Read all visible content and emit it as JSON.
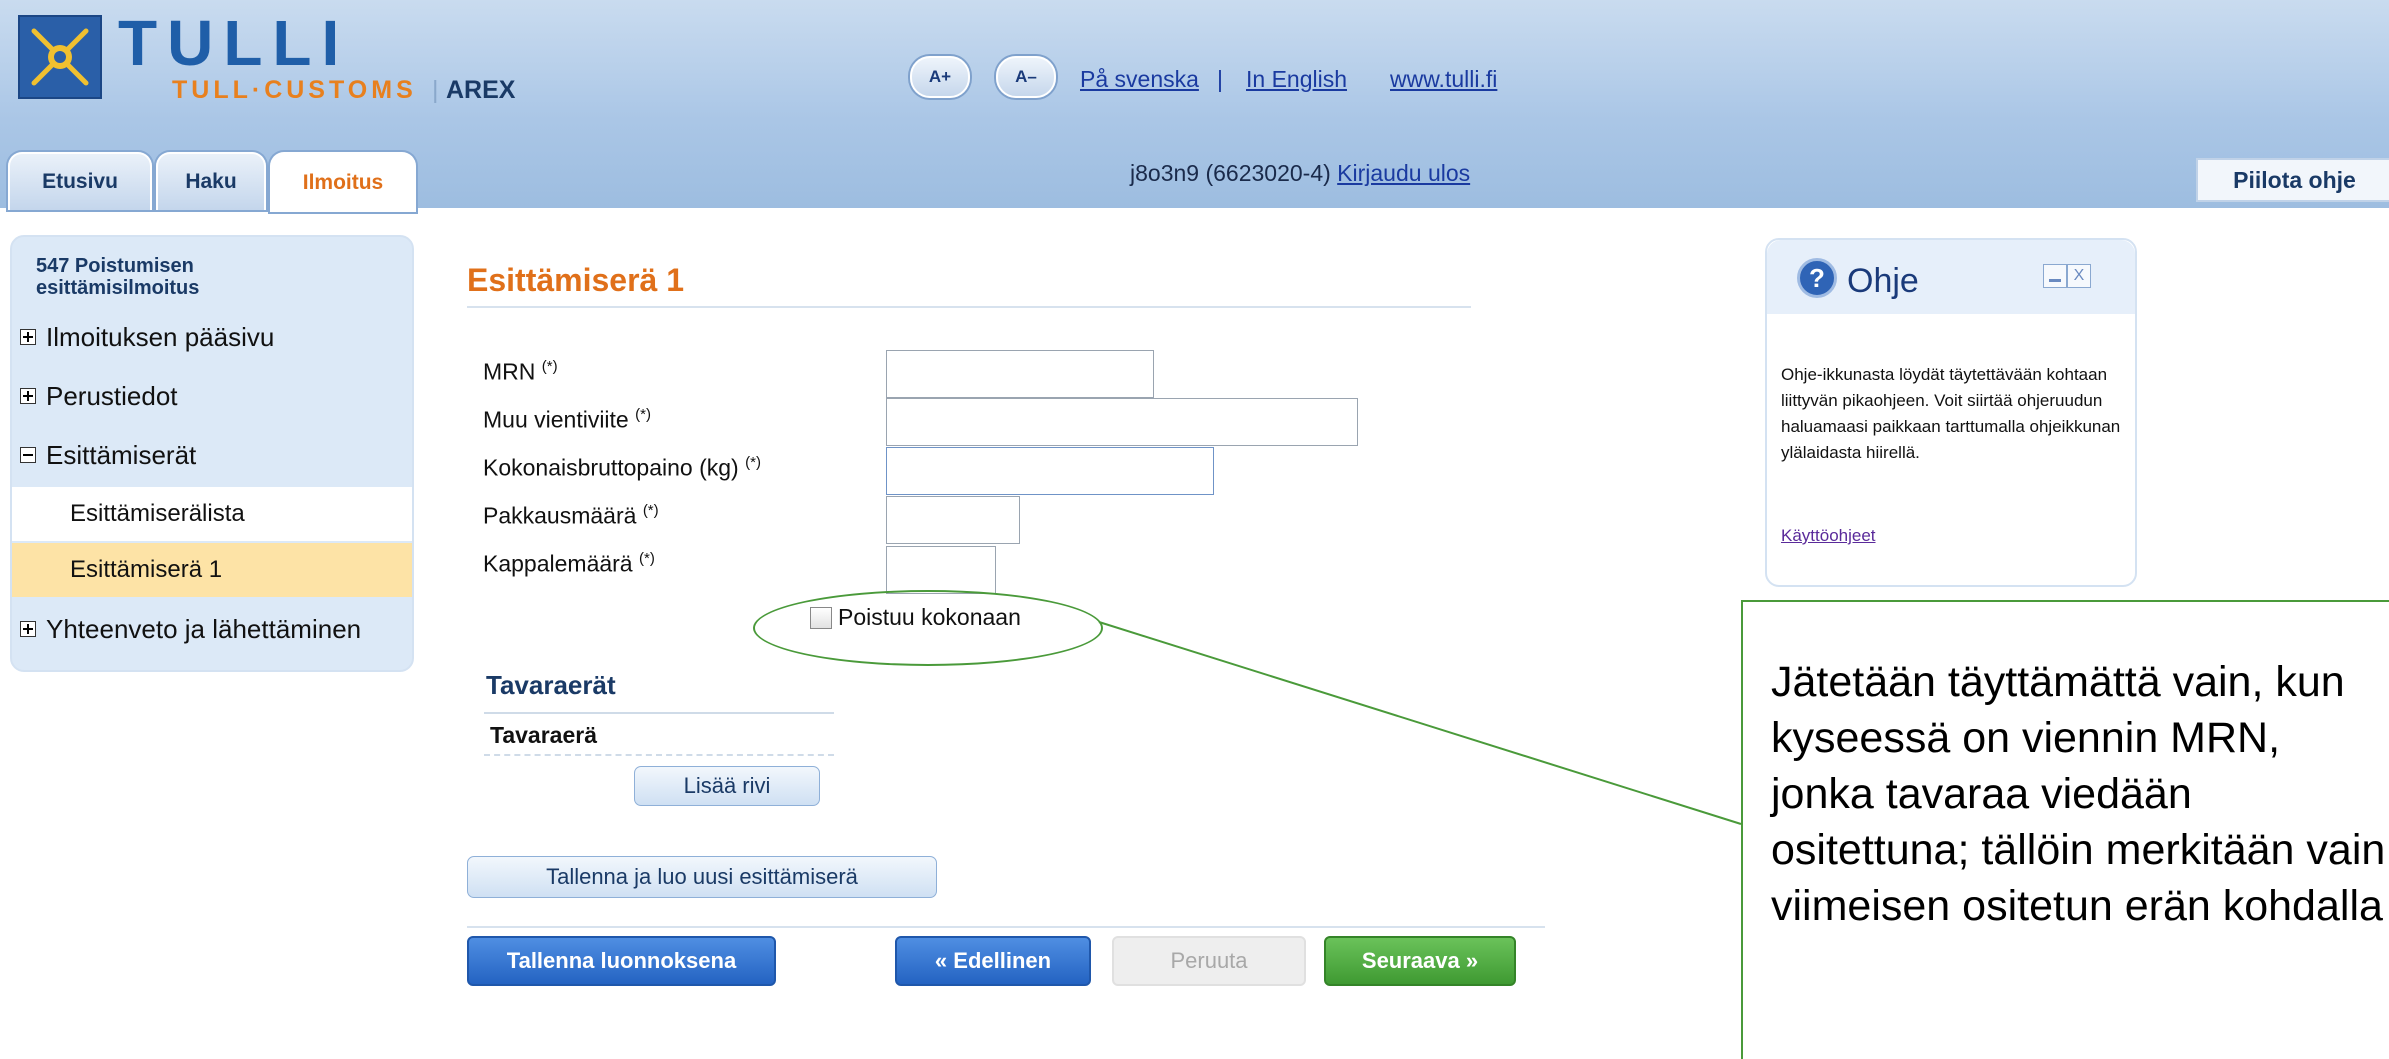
{
  "header": {
    "logo_title": "TULLI",
    "logo_subtitle": "TULL·CUSTOMS",
    "app_separator": "|",
    "app_name": "AREX",
    "font_increase_label": "A+",
    "font_decrease_label": "A–",
    "link_swedish": "På svenska",
    "link_separator": "|",
    "link_english": "In English",
    "link_site": "www.tulli.fi"
  },
  "tabs": [
    {
      "label": "Etusivu",
      "active": false
    },
    {
      "label": "Haku",
      "active": false
    },
    {
      "label": "Ilmoitus",
      "active": true
    }
  ],
  "user": {
    "info": "j8o3n9 (6623020-4)",
    "logout_label": "Kirjaudu ulos"
  },
  "hide_help_label": "Piilota ohje",
  "sidebar": {
    "title": "547 Poistumisen esittämisilmoitus",
    "items": [
      {
        "label": "Ilmoituksen pääsivu",
        "expander": "+"
      },
      {
        "label": "Perustiedot",
        "expander": "+"
      },
      {
        "label": "Esittämiserät",
        "expander": "−"
      },
      {
        "label": "Esittämiserälista"
      },
      {
        "label": "Esittämiserä 1",
        "selected": true
      },
      {
        "label": "Yhteenveto ja lähettäminen",
        "expander": "+"
      }
    ]
  },
  "form": {
    "title": "Esittämiserä 1",
    "required_marker": "(*)",
    "fields": [
      {
        "label": "MRN",
        "value": ""
      },
      {
        "label": "Muu vientiviite",
        "value": ""
      },
      {
        "label": "Kokonaisbruttopaino (kg)",
        "value": ""
      },
      {
        "label": "Pakkausmäärä",
        "value": ""
      },
      {
        "label": "Kappalemäärä",
        "value": ""
      }
    ],
    "checkbox_label": "Poistuu kokonaan",
    "checkbox_checked": false,
    "goods_section_title": "Tavaraerät",
    "goods_column_header": "Tavaraerä",
    "add_row_label": "Lisää rivi",
    "save_new_label": "Tallenna ja luo uusi esittämiserä"
  },
  "actions": {
    "save_draft_label": "Tallenna luonnoksena",
    "previous_label": "«  Edellinen",
    "cancel_label": "Peruuta",
    "next_label": "Seuraava  »"
  },
  "help": {
    "title": "Ohje",
    "icon": "question-icon",
    "close_glyph": "X",
    "text": "Ohje-ikkunasta löydät täytettävään kohtaan liittyvän pikaohjeen. Voit siirtää ohjeruudun haluamaasi paikkaan tarttumalla ohjeikkunan ylälaidasta hiirellä.",
    "link_label": "Käyttöohjeet"
  },
  "callout": {
    "text": "Jätetään täyttämättä vain, kun kyseessä on viennin MRN, jonka tavaraa viedään ositettuna; tällöin merkitään vain viimeisen ositetun erän kohdalla"
  },
  "colors": {
    "brand_blue": "#1f5ea8",
    "accent_orange": "#e0701a",
    "next_green": "#3f9a32",
    "annotation_green": "#4a9a3a"
  }
}
